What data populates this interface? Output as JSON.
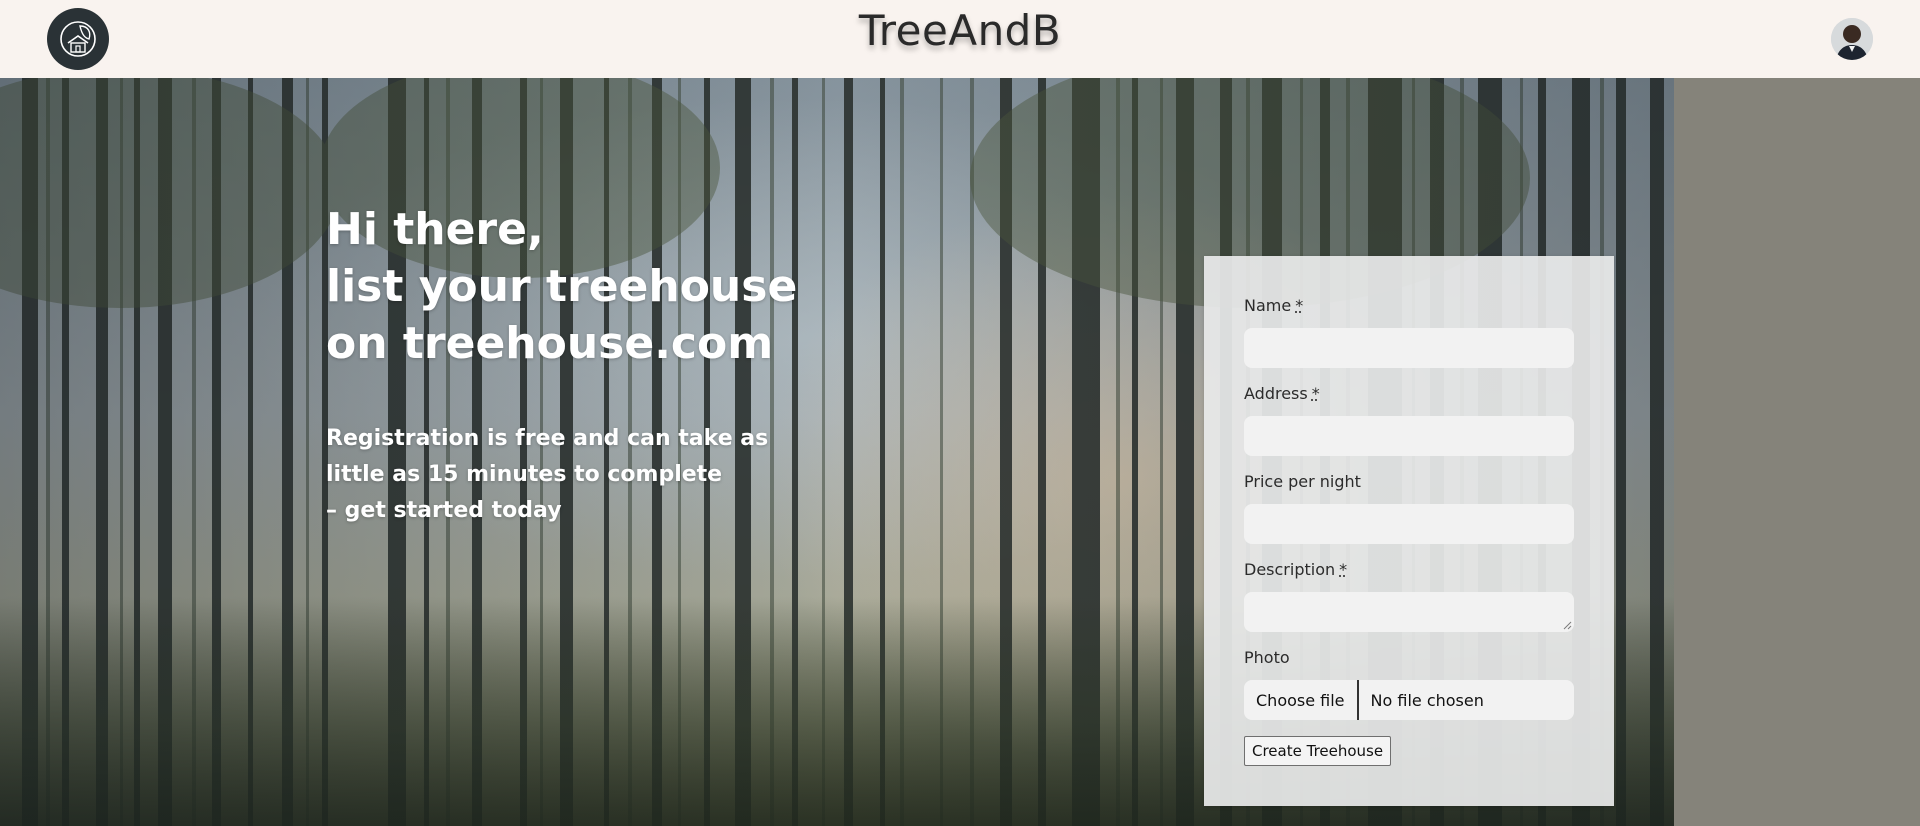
{
  "header": {
    "brand": "TreeAndB",
    "logo_icon": "treehouse-logo-icon",
    "avatar_icon": "user-avatar"
  },
  "hero": {
    "headline_line1": "Hi there,",
    "headline_line2": "list your treehouse",
    "headline_line3": "on treehouse.com",
    "sub_line1": "Registration is free and can take as",
    "sub_line2": "little as 15 minutes to complete",
    "sub_line3": "– get started today"
  },
  "form": {
    "name_label": "Name",
    "address_label": "Address",
    "price_label": "Price per night",
    "description_label": "Description",
    "photo_label": "Photo",
    "required_marker": "*",
    "choose_file": "Choose file",
    "no_file": "No file chosen",
    "submit_label": "Create Treehouse",
    "name_value": "",
    "address_value": "",
    "price_value": "",
    "description_value": ""
  },
  "colors": {
    "header_bg": "#f9f3ef",
    "logo_bg": "#2a3236",
    "side_panel": "#85837a",
    "card_bg": "#e8e9ea"
  }
}
